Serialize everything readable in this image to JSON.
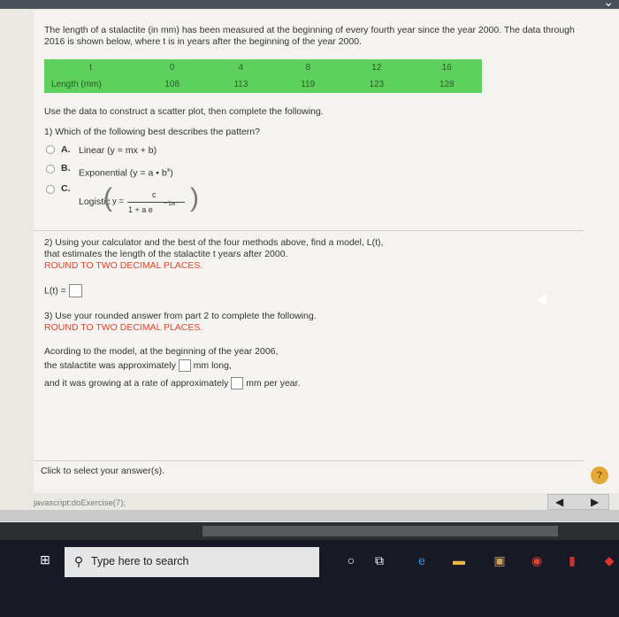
{
  "question": {
    "intro": "The length of a stalactite (in mm) has been measured at the beginning of every fourth year since the year 2000. The data through 2016 is shown below, where t is in years after the beginning of the year 2000."
  },
  "table": {
    "row1_label": "t",
    "row2_label": "Length (mm)",
    "t_values": [
      "0",
      "4",
      "8",
      "12",
      "16"
    ],
    "length_values": [
      "108",
      "113",
      "119",
      "123",
      "128"
    ]
  },
  "instructions": "Use the data to construct a scatter plot, then complete the following.",
  "part1": {
    "prompt": "1) Which of the following best describes the pattern?",
    "options": [
      {
        "letter": "A.",
        "text": "Linear (y = mx + b)"
      },
      {
        "letter": "B.",
        "text": "Exponential (y = a • b"
      },
      {
        "letter": "C.",
        "text": "Logistic"
      }
    ],
    "exp_sup": "x",
    "exp_close": ")",
    "logistic": {
      "y": "y =",
      "num": "c",
      "den": "1 + a e",
      "den_sup": "− bx"
    }
  },
  "part2": {
    "line1": "2) Using your calculator and the best of the four methods above, find a model, L(t),",
    "line2": "that estimates the length of the stalactite t years after 2000.",
    "round": "ROUND TO TWO DECIMAL PLACES.",
    "lt_label": "L(t) ="
  },
  "part3": {
    "prompt": "3) Use your rounded answer from part 2 to complete the following.",
    "round": "ROUND TO TWO DECIMAL PLACES.",
    "line1": "Acording to the model, at the beginning of the year 2006,",
    "line2a": "the stalactite was approximately",
    "line2b": "mm long,",
    "line3a": "and it was growing at a rate of approximately",
    "line3b": "mm per year."
  },
  "footer": {
    "select_prompt": "Click to select your answer(s).",
    "help": "?",
    "status": "javascript:doExercise(7);"
  },
  "taskbar": {
    "search_placeholder": "Type here to search"
  },
  "colors": {
    "table_green": "#5ed05c",
    "instruction_red": "#e0442e",
    "help_orange": "#e3a835"
  }
}
